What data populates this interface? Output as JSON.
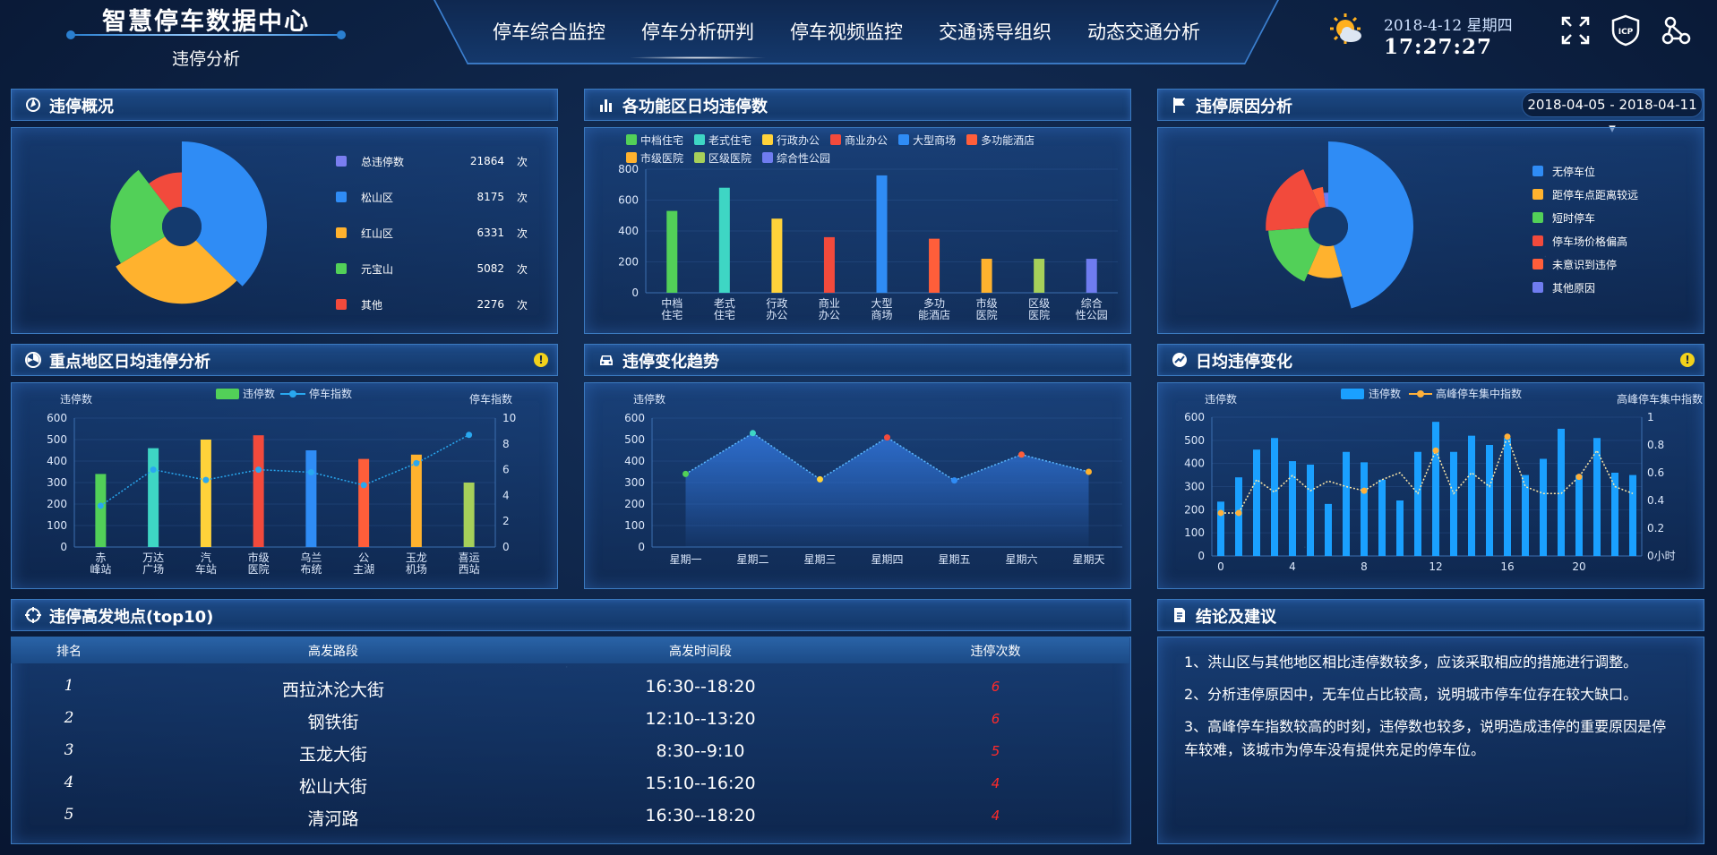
{
  "header": {
    "title": "智慧停车数据中心",
    "subtitle": "违停分析",
    "nav": [
      "停车综合监控",
      "停车分析研判",
      "停车视频监控",
      "交通诱导组织",
      "动态交通分析"
    ],
    "active_nav": 1,
    "date": "2018-4-12  星期四",
    "time": "17:27:27",
    "icons": [
      "fullscreen-icon",
      "icp-icon",
      "network-icon"
    ]
  },
  "panels": {
    "overview": {
      "title": "违停概况"
    },
    "function_area": {
      "title": "各功能区日均违停数"
    },
    "reason": {
      "title": "违停原因分析",
      "date_range": "2018-04-05 - 2018-04-11 ▾"
    },
    "key_area": {
      "title": "重点地区日均违停分析"
    },
    "trend": {
      "title": "违停变化趋势"
    },
    "daily": {
      "title": "日均违停变化"
    },
    "top10": {
      "title": "违停高发地点(top10)"
    },
    "advice": {
      "title": "结论及建议"
    }
  },
  "overview_legend": [
    {
      "name": "总违停数",
      "value": "21864",
      "unit": "次",
      "color": "#7a7ef0"
    },
    {
      "name": "松山区",
      "value": "8175",
      "unit": "次",
      "color": "#2f8cf5"
    },
    {
      "name": "红山区",
      "value": "6331",
      "unit": "次",
      "color": "#ffb22e"
    },
    {
      "name": "元宝山",
      "value": "5082",
      "unit": "次",
      "color": "#52d058"
    },
    {
      "name": "其他",
      "value": "2276",
      "unit": "次",
      "color": "#f24a3c"
    }
  ],
  "reason_legend": [
    {
      "name": "无停车位",
      "color": "#2f8cf5"
    },
    {
      "name": "距停车点距离较远",
      "color": "#ffb22e"
    },
    {
      "name": "短时停车",
      "color": "#52d058"
    },
    {
      "name": "停车场价格偏高",
      "color": "#f24a3c"
    },
    {
      "name": "未意识到违停",
      "color": "#ff5e3a"
    },
    {
      "name": "其他原因",
      "color": "#6f7cf0"
    }
  ],
  "table": {
    "headers": [
      "排名",
      "高发路段",
      "高发时间段",
      "违停次数"
    ],
    "rows": [
      {
        "rank": "1",
        "road": "西拉沐沦大街",
        "time": "16:30--18:20",
        "count": "6"
      },
      {
        "rank": "2",
        "road": "钢铁街",
        "time": "12:10--13:20",
        "count": "6"
      },
      {
        "rank": "3",
        "road": "玉龙大街",
        "time": "8:30--9:10",
        "count": "5"
      },
      {
        "rank": "4",
        "road": "松山大街",
        "time": "15:10--16:20",
        "count": "4"
      },
      {
        "rank": "5",
        "road": "清河路",
        "time": "16:30--18:20",
        "count": "4"
      }
    ]
  },
  "advice": [
    "1、洪山区与其他地区相比违停数较多，应该采取相应的措施进行调整。",
    "2、分析违停原因中，无车位占比较高，说明城市停车位存在较大缺口。",
    "3、高峰停车指数较高的时刻，违停数也较多，说明造成违停的重要原因是停车较难，该城市为停车没有提供充足的停车位。"
  ],
  "chart_data": [
    {
      "type": "pie",
      "id": "overview_rose",
      "labels": [
        "松山区",
        "红山区",
        "元宝山",
        "其他"
      ],
      "values": [
        8175,
        6331,
        5082,
        2276
      ],
      "colors": [
        "#2f8cf5",
        "#ffb22e",
        "#52d058",
        "#f24a3c"
      ]
    },
    {
      "type": "bar",
      "id": "function_area",
      "legend": [
        "中档住宅",
        "老式住宅",
        "行政办公",
        "商业办公",
        "大型商场",
        "多功能酒店",
        "市级医院",
        "区级医院",
        "综合性公园"
      ],
      "categories": [
        "中档\n住宅",
        "老式\n住宅",
        "行政\n办公",
        "商业\n办公",
        "大型\n商场",
        "多功\n能酒店",
        "市级\n医院",
        "区级\n医院",
        "综合\n性公园"
      ],
      "values": [
        530,
        680,
        480,
        360,
        760,
        350,
        220,
        220,
        220
      ],
      "colors": [
        "#52d058",
        "#3ed6c4",
        "#ffd23a",
        "#f24a3c",
        "#2f8cf5",
        "#ff5e3a",
        "#ffb22e",
        "#a6d05a",
        "#6f7cf0"
      ],
      "ylim": [
        0,
        800
      ],
      "yticks": [
        0,
        200,
        400,
        600,
        800
      ]
    },
    {
      "type": "pie",
      "id": "reason_rose",
      "labels": [
        "无停车位",
        "距停车点距离较远",
        "短时停车",
        "停车场价格偏高",
        "未意识到违停",
        "其他原因"
      ],
      "values": [
        42,
        10,
        16,
        18,
        4,
        2
      ],
      "colors": [
        "#2f8cf5",
        "#ffb22e",
        "#52d058",
        "#f24a3c",
        "#ff5e3a",
        "#6f7cf0"
      ]
    },
    {
      "type": "bar",
      "id": "key_area",
      "ylabel": "违停数",
      "y2label": "停车指数",
      "legend": [
        "违停数",
        "停车指数"
      ],
      "categories": [
        "赤\n峰站",
        "万达\n广场",
        "汽\n车站",
        "市级\n医院",
        "乌兰\n布统",
        "公\n主湖",
        "玉龙\n机场",
        "喜运\n西站"
      ],
      "values": [
        340,
        460,
        500,
        520,
        450,
        410,
        430,
        300
      ],
      "colors": [
        "#52d058",
        "#3ed6c4",
        "#ffd23a",
        "#f24a3c",
        "#2f8cf5",
        "#ff5e3a",
        "#ffb22e",
        "#a6d05a"
      ],
      "index": [
        3.2,
        6,
        5.2,
        6,
        5.8,
        4.8,
        6.5,
        8.7
      ],
      "ylim": [
        0,
        600
      ],
      "yticks": [
        0,
        100,
        200,
        300,
        400,
        500,
        600
      ],
      "y2lim": [
        0,
        10
      ],
      "y2ticks": [
        0,
        2,
        4,
        6,
        8,
        10
      ]
    },
    {
      "type": "area",
      "id": "trend",
      "ylabel": "违停数",
      "categories": [
        "星期一",
        "星期二",
        "星期三",
        "星期四",
        "星期五",
        "星期六",
        "星期天"
      ],
      "values": [
        340,
        530,
        315,
        510,
        310,
        430,
        350
      ],
      "point_colors": [
        "#52d058",
        "#3ed6c4",
        "#ffd23a",
        "#f24a3c",
        "#2f8cf5",
        "#ff5e3a",
        "#ffb22e"
      ],
      "ylim": [
        0,
        600
      ],
      "yticks": [
        0,
        100,
        200,
        300,
        400,
        500,
        600
      ]
    },
    {
      "type": "bar",
      "id": "daily",
      "ylabel": "违停数",
      "y2label": "高峰停车集中指数",
      "legend": [
        "违停数",
        "高峰停车集中指数"
      ],
      "x": [
        0,
        1,
        2,
        3,
        4,
        5,
        6,
        7,
        8,
        9,
        10,
        11,
        12,
        13,
        14,
        15,
        16,
        17,
        18,
        19,
        20,
        21,
        22,
        23
      ],
      "values": [
        235,
        340,
        460,
        510,
        410,
        395,
        225,
        450,
        405,
        330,
        240,
        450,
        580,
        450,
        520,
        480,
        510,
        350,
        420,
        550,
        350,
        510,
        360,
        350
      ],
      "index": [
        0.31,
        0.31,
        0.55,
        0.46,
        0.58,
        0.47,
        0.54,
        0.5,
        0.47,
        0.55,
        0.6,
        0.45,
        0.76,
        0.45,
        0.6,
        0.5,
        0.86,
        0.5,
        0.45,
        0.45,
        0.57,
        0.76,
        0.5,
        0.45
      ],
      "xticks": [
        "0",
        "4",
        "8",
        "12",
        "16",
        "20"
      ],
      "ylim": [
        0,
        600
      ],
      "yticks": [
        0,
        100,
        200,
        300,
        400,
        500,
        600
      ],
      "y2lim": [
        0,
        1
      ],
      "y2ticks": [
        "0小时",
        "0.2",
        "0.4",
        "0.6",
        "0.8",
        "1"
      ]
    }
  ]
}
